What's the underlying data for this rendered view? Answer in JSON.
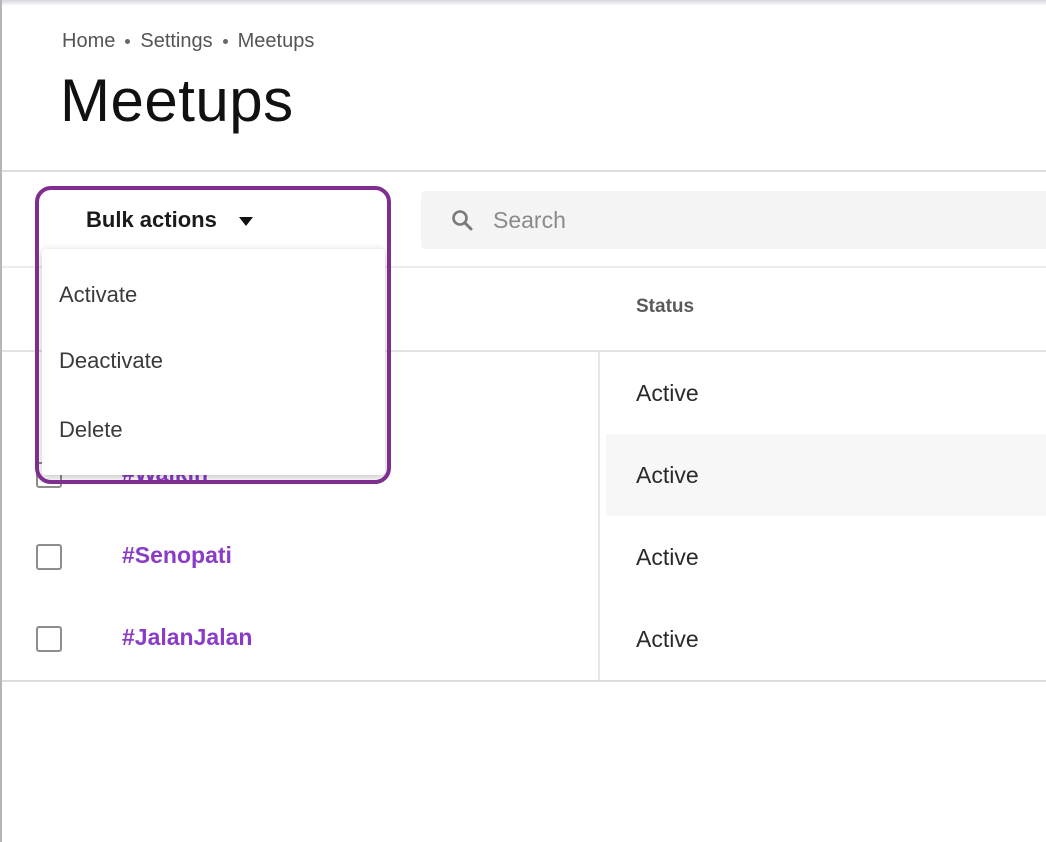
{
  "breadcrumb": [
    "Home",
    "Settings",
    "Meetups"
  ],
  "page_title": "Meetups",
  "toolbar": {
    "bulk_actions_label": "Bulk actions"
  },
  "search": {
    "placeholder": "Search"
  },
  "dropdown": {
    "items": [
      "Activate",
      "Deactivate",
      "Delete"
    ]
  },
  "table": {
    "columns": {
      "status": "Status"
    },
    "rows": [
      {
        "name": "",
        "status": "Active"
      },
      {
        "name": "#Walkin",
        "status": "Active"
      },
      {
        "name": "#Senopati",
        "status": "Active"
      },
      {
        "name": "#JalanJalan",
        "status": "Active"
      }
    ]
  },
  "colors": {
    "accent_purple": "#8a3cc9",
    "highlight_border": "#7d2e8e"
  }
}
